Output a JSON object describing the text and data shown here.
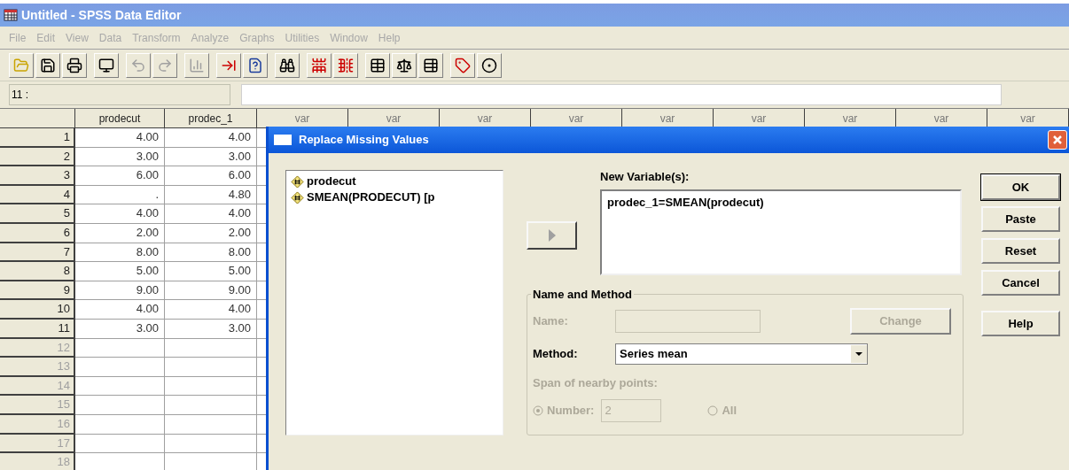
{
  "window": {
    "title": "Untitled - SPSS Data Editor"
  },
  "menu": [
    "File",
    "Edit",
    "View",
    "Data",
    "Transform",
    "Analyze",
    "Graphs",
    "Utilities",
    "Window",
    "Help"
  ],
  "toolbar": [
    [
      {
        "disabled": false
      },
      {
        "disabled": false
      },
      {
        "disabled": false
      }
    ],
    [
      {
        "disabled": false
      }
    ],
    [
      {
        "disabled": true
      },
      {
        "disabled": true
      }
    ],
    [
      {
        "disabled": true
      }
    ],
    [
      {
        "disabled": false
      },
      {
        "disabled": false
      }
    ],
    [
      {
        "disabled": false
      }
    ],
    [
      {
        "disabled": false
      },
      {
        "disabled": false
      }
    ],
    [
      {
        "disabled": false
      },
      {
        "disabled": false
      },
      {
        "disabled": false
      }
    ],
    [
      {
        "disabled": false
      },
      {
        "disabled": false
      }
    ]
  ],
  "cell_editor": {
    "cell": "11 :"
  },
  "grid": {
    "columns": [
      "prodecut",
      "prodec_1",
      "var",
      "var",
      "var",
      "var",
      "var",
      "var",
      "var",
      "var",
      "var"
    ],
    "rows": [
      {
        "number": "1",
        "has_data": true,
        "cells": [
          "4.00",
          "4.00"
        ]
      },
      {
        "number": "2",
        "has_data": true,
        "cells": [
          "3.00",
          "3.00"
        ]
      },
      {
        "number": "3",
        "has_data": true,
        "cells": [
          "6.00",
          "6.00"
        ]
      },
      {
        "number": "4",
        "has_data": true,
        "cells": [
          ".",
          "4.80"
        ]
      },
      {
        "number": "5",
        "has_data": true,
        "cells": [
          "4.00",
          "4.00"
        ]
      },
      {
        "number": "6",
        "has_data": true,
        "cells": [
          "2.00",
          "2.00"
        ]
      },
      {
        "number": "7",
        "has_data": true,
        "cells": [
          "8.00",
          "8.00"
        ]
      },
      {
        "number": "8",
        "has_data": true,
        "cells": [
          "5.00",
          "5.00"
        ]
      },
      {
        "number": "9",
        "has_data": true,
        "cells": [
          "9.00",
          "9.00"
        ]
      },
      {
        "number": "10",
        "has_data": true,
        "cells": [
          "4.00",
          "4.00"
        ]
      },
      {
        "number": "11",
        "has_data": true,
        "cells": [
          "3.00",
          "3.00"
        ]
      },
      {
        "number": "12",
        "has_data": false,
        "cells": []
      },
      {
        "number": "13",
        "has_data": false,
        "cells": []
      },
      {
        "number": "14",
        "has_data": false,
        "cells": []
      },
      {
        "number": "15",
        "has_data": false,
        "cells": []
      },
      {
        "number": "16",
        "has_data": false,
        "cells": []
      },
      {
        "number": "17",
        "has_data": false,
        "cells": []
      },
      {
        "number": "18",
        "has_data": false,
        "cells": []
      }
    ]
  },
  "dialog": {
    "title": "Replace Missing Values",
    "variables": [
      "prodecut",
      "SMEAN(PRODECUT) [p"
    ],
    "new_variables_label": "New Variable(s):",
    "new_variables": "prodec_1=SMEAN(prodecut)",
    "group_title": "Name and Method",
    "name_label": "Name:",
    "name_disabled": true,
    "change_button": {
      "label": "Change",
      "disabled": true
    },
    "method_label": "Method:",
    "method": "Series mean",
    "span_label": "Span of nearby points:",
    "span_disabled": true,
    "radios": [
      {
        "label": "Number:",
        "selected": true
      },
      {
        "label": "All",
        "selected": false
      }
    ],
    "number_value": "2",
    "buttons": [
      {
        "label": "OK",
        "default": true
      },
      {
        "label": "Paste",
        "default": false
      },
      {
        "label": "Reset",
        "default": false
      },
      {
        "label": "Cancel",
        "default": false
      },
      {
        "label": "Help",
        "default": false
      }
    ]
  }
}
